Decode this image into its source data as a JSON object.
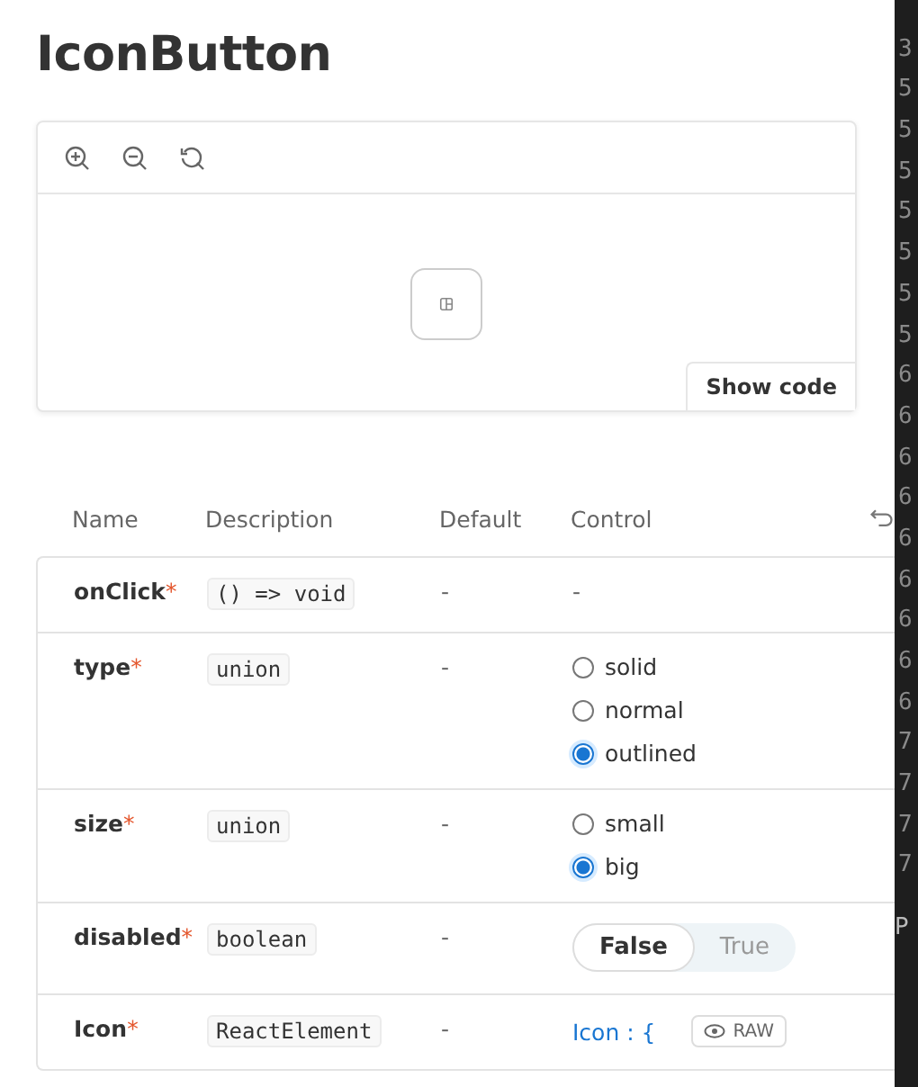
{
  "title": "IconButton",
  "preview": {
    "tools": [
      {
        "kind": "zoom-in"
      },
      {
        "kind": "zoom-out"
      },
      {
        "kind": "reset"
      }
    ],
    "show_code": "Show code"
  },
  "table": {
    "columns": [
      "Name",
      "Description",
      "Default",
      "Control"
    ],
    "required_mark": "*",
    "rows": [
      {
        "name": "onClick",
        "required": true,
        "type": "() => void",
        "default": "-",
        "control": {
          "kind": "text",
          "text": "-"
        }
      },
      {
        "name": "type",
        "required": true,
        "type": "union",
        "default": "-",
        "control": {
          "kind": "radio",
          "options": [
            {
              "label": "solid",
              "selected": false
            },
            {
              "label": "normal",
              "selected": false
            },
            {
              "label": "outlined",
              "selected": true
            }
          ]
        }
      },
      {
        "name": "size",
        "required": true,
        "type": "union",
        "default": "-",
        "control": {
          "kind": "radio",
          "options": [
            {
              "label": "small",
              "selected": false
            },
            {
              "label": "big",
              "selected": true
            }
          ]
        }
      },
      {
        "name": "disabled",
        "required": true,
        "type": "boolean",
        "default": "-",
        "control": {
          "kind": "toggle",
          "options": [
            {
              "label": "False",
              "selected": true
            },
            {
              "label": "True",
              "selected": false
            }
          ]
        }
      },
      {
        "name": "Icon",
        "required": true,
        "type": "ReactElement",
        "default": "-",
        "control": {
          "kind": "object",
          "text": "Icon : {",
          "raw": "RAW"
        }
      }
    ]
  },
  "editor_gutter": {
    "lines": [
      "3",
      "5",
      "5",
      "5",
      "5",
      "5",
      "5",
      "5",
      "6",
      "6",
      "6",
      "6",
      "6",
      "6",
      "6",
      "6",
      "6",
      "7",
      "7",
      "7",
      "7"
    ],
    "tail": "P"
  }
}
